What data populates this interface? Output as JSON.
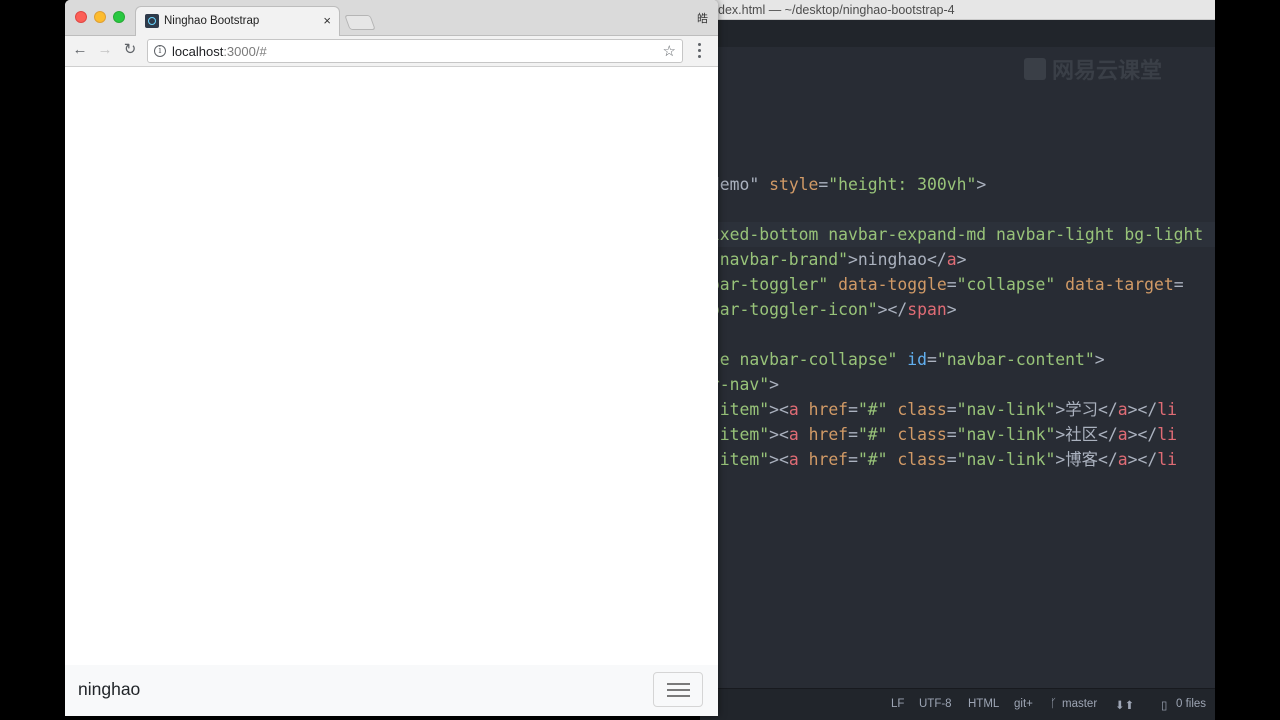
{
  "editor": {
    "title": "dex.html — ~/desktop/ninghao-bootstrap-4",
    "watermark": "网易云课堂",
    "code_lines": [
      {
        "parts": [
          {
            "t": "plain",
            "v": " demo\" "
          },
          {
            "t": "attr",
            "v": "style"
          },
          {
            "t": "plain",
            "v": "="
          },
          {
            "t": "str",
            "v": "\"height: 300vh\""
          },
          {
            "t": "plain",
            "v": ">"
          }
        ]
      },
      {
        "parts": []
      },
      {
        "highlight": true,
        "parts": [
          {
            "t": "str",
            "v": "fixed-bottom navbar-expand-md navbar-light bg-light"
          }
        ]
      },
      {
        "parts": [
          {
            "t": "str",
            "v": "=\"navbar-brand\""
          },
          {
            "t": "plain",
            "v": ">ninghao</"
          },
          {
            "t": "tag",
            "v": "a"
          },
          {
            "t": "plain",
            "v": ">"
          }
        ]
      },
      {
        "parts": [
          {
            "t": "str",
            "v": "vbar-toggler\""
          },
          {
            "t": "plain",
            "v": " "
          },
          {
            "t": "attr",
            "v": "data-toggle"
          },
          {
            "t": "plain",
            "v": "="
          },
          {
            "t": "str",
            "v": "\"collapse\""
          },
          {
            "t": "plain",
            "v": " "
          },
          {
            "t": "attr",
            "v": "data-target"
          },
          {
            "t": "plain",
            "v": "="
          }
        ]
      },
      {
        "parts": [
          {
            "t": "str",
            "v": "vbar-toggler-icon\""
          },
          {
            "t": "plain",
            "v": "></"
          },
          {
            "t": "tag",
            "v": "span"
          },
          {
            "t": "plain",
            "v": ">"
          }
        ]
      },
      {
        "parts": []
      },
      {
        "parts": [
          {
            "t": "str",
            "v": "pse navbar-collapse\""
          },
          {
            "t": "plain",
            "v": " "
          },
          {
            "t": "id",
            "v": "id"
          },
          {
            "t": "plain",
            "v": "="
          },
          {
            "t": "str",
            "v": "\"navbar-content\""
          },
          {
            "t": "plain",
            "v": ">"
          }
        ]
      },
      {
        "parts": [
          {
            "t": "str",
            "v": "ar-nav\""
          },
          {
            "t": "plain",
            "v": ">"
          }
        ]
      },
      {
        "parts": [
          {
            "t": "str",
            "v": "v-item\""
          },
          {
            "t": "plain",
            "v": "><"
          },
          {
            "t": "tag",
            "v": "a"
          },
          {
            "t": "plain",
            "v": " "
          },
          {
            "t": "attr",
            "v": "href"
          },
          {
            "t": "plain",
            "v": "="
          },
          {
            "t": "str",
            "v": "\"#\""
          },
          {
            "t": "plain",
            "v": " "
          },
          {
            "t": "attr",
            "v": "class"
          },
          {
            "t": "plain",
            "v": "="
          },
          {
            "t": "str",
            "v": "\"nav-link\""
          },
          {
            "t": "plain",
            "v": ">学习</"
          },
          {
            "t": "tag",
            "v": "a"
          },
          {
            "t": "plain",
            "v": "></"
          },
          {
            "t": "tag",
            "v": "li"
          }
        ]
      },
      {
        "parts": [
          {
            "t": "str",
            "v": "v-item\""
          },
          {
            "t": "plain",
            "v": "><"
          },
          {
            "t": "tag",
            "v": "a"
          },
          {
            "t": "plain",
            "v": " "
          },
          {
            "t": "attr",
            "v": "href"
          },
          {
            "t": "plain",
            "v": "="
          },
          {
            "t": "str",
            "v": "\"#\""
          },
          {
            "t": "plain",
            "v": " "
          },
          {
            "t": "attr",
            "v": "class"
          },
          {
            "t": "plain",
            "v": "="
          },
          {
            "t": "str",
            "v": "\"nav-link\""
          },
          {
            "t": "plain",
            "v": ">社区</"
          },
          {
            "t": "tag",
            "v": "a"
          },
          {
            "t": "plain",
            "v": "></"
          },
          {
            "t": "tag",
            "v": "li"
          }
        ]
      },
      {
        "parts": [
          {
            "t": "str",
            "v": "v-item\""
          },
          {
            "t": "plain",
            "v": "><"
          },
          {
            "t": "tag",
            "v": "a"
          },
          {
            "t": "plain",
            "v": " "
          },
          {
            "t": "attr",
            "v": "href"
          },
          {
            "t": "plain",
            "v": "="
          },
          {
            "t": "str",
            "v": "\"#\""
          },
          {
            "t": "plain",
            "v": " "
          },
          {
            "t": "attr",
            "v": "class"
          },
          {
            "t": "plain",
            "v": "="
          },
          {
            "t": "str",
            "v": "\"nav-link\""
          },
          {
            "t": "plain",
            "v": ">博客</"
          },
          {
            "t": "tag",
            "v": "a"
          },
          {
            "t": "plain",
            "v": "></"
          },
          {
            "t": "tag",
            "v": "li"
          }
        ]
      }
    ],
    "colors": {
      "attr": "#d19a66",
      "str": "#98c379",
      "tag": "#e06c75",
      "id": "#61afef",
      "plain": "#abb2bf"
    },
    "status": {
      "line_ending": "LF",
      "encoding": "UTF-8",
      "grammar": "HTML",
      "git_label": "git+",
      "branch": "master",
      "branch_icon": "git-branch-icon",
      "fetch_icons": "arrow-down-up-icon",
      "files": "0 files",
      "files_icon": "file-icon"
    }
  },
  "browser": {
    "tab_title": "Ninghao Bootstrap",
    "tab_close": "×",
    "profile_char": "皓",
    "url_host": "localhost",
    "url_rest": ":3000/#",
    "toolbar_icons": {
      "back": "←",
      "forward": "→",
      "reload": "↻",
      "star": "☆"
    },
    "page": {
      "brand": "ninghao",
      "toggler_icon": "hamburger-icon"
    }
  }
}
